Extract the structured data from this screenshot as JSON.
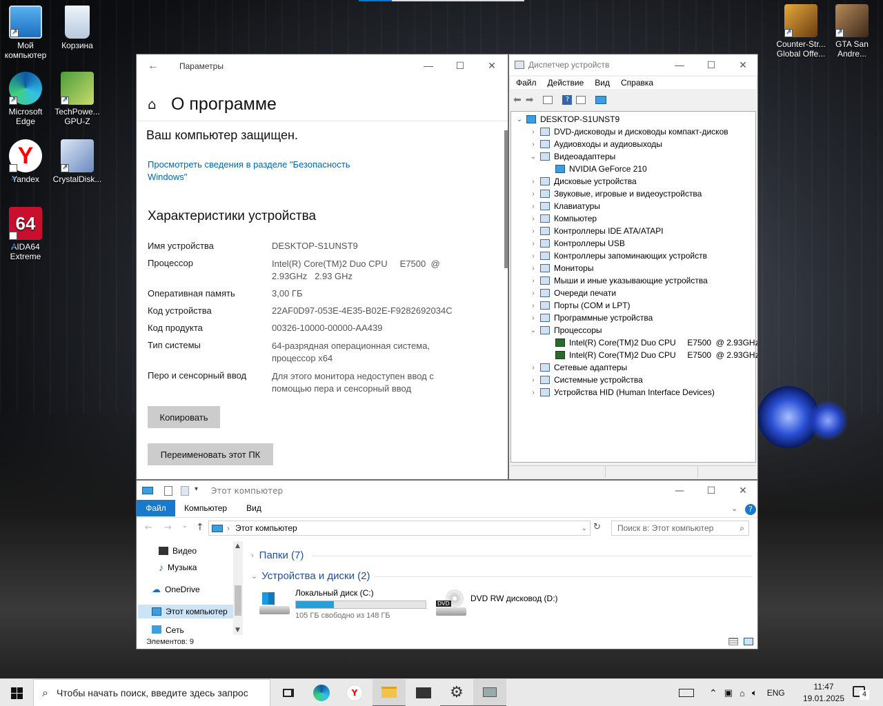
{
  "desktop": {
    "icons": [
      {
        "label": "Мой компьютер"
      },
      {
        "label": "Корзина"
      },
      {
        "label": "Microsoft Edge"
      },
      {
        "label": "TechPowe... GPU-Z"
      },
      {
        "label": "Yandex"
      },
      {
        "label": "CrystalDisk..."
      },
      {
        "label": "AIDA64 Extreme"
      },
      {
        "label": "Counter-Str... Global Offe..."
      },
      {
        "label": "GTA San Andre..."
      }
    ]
  },
  "settings": {
    "window_title": "Параметры",
    "page_title": "О программе",
    "protected_text": "Ваш компьютер защищен.",
    "security_link": "Просмотреть сведения в разделе \"Безопасность Windows\"",
    "specs_heading": "Характеристики устройства",
    "specs": [
      {
        "label": "Имя устройства",
        "value": "DESKTOP-S1UNST9"
      },
      {
        "label": "Процессор",
        "value": "Intel(R) Core(TM)2 Duo CPU     E7500  @ 2.93GHz   2.93 GHz"
      },
      {
        "label": "Оперативная память",
        "value": "3,00 ГБ"
      },
      {
        "label": "Код устройства",
        "value": "22AF0D97-053E-4E35-B02E-F9282692034C"
      },
      {
        "label": "Код продукта",
        "value": "00326-10000-00000-AA439"
      },
      {
        "label": "Тип системы",
        "value": "64-разрядная операционная система, процессор x64"
      },
      {
        "label": "Перо и сенсорный ввод",
        "value": "Для этого монитора недоступен ввод с помощью пера и сенсорный ввод"
      }
    ],
    "copy_button": "Копировать",
    "rename_button": "Переименовать этот ПК"
  },
  "devmgr": {
    "window_title": "Диспетчер устройств",
    "menu": [
      "Файл",
      "Действие",
      "Вид",
      "Справка"
    ],
    "root": "DESKTOP-S1UNST9",
    "items": [
      {
        "label": "DVD-дисководы и дисководы компакт-дисков",
        "expanded": false
      },
      {
        "label": "Аудиовходы и аудиовыходы",
        "expanded": false
      },
      {
        "label": "Видеоадаптеры",
        "expanded": true
      },
      {
        "label": "NVIDIA GeForce 210",
        "child": true
      },
      {
        "label": "Дисковые устройства",
        "expanded": false
      },
      {
        "label": "Звуковые, игровые и видеоустройства",
        "expanded": false
      },
      {
        "label": "Клавиатуры",
        "expanded": false
      },
      {
        "label": "Компьютер",
        "expanded": false
      },
      {
        "label": "Контроллеры IDE ATA/ATAPI",
        "expanded": false
      },
      {
        "label": "Контроллеры USB",
        "expanded": false
      },
      {
        "label": "Контроллеры запоминающих устройств",
        "expanded": false
      },
      {
        "label": "Мониторы",
        "expanded": false
      },
      {
        "label": "Мыши и иные указывающие устройства",
        "expanded": false
      },
      {
        "label": "Очереди печати",
        "expanded": false
      },
      {
        "label": "Порты (COM и LPT)",
        "expanded": false
      },
      {
        "label": "Программные устройства",
        "expanded": false
      },
      {
        "label": "Процессоры",
        "expanded": true
      },
      {
        "label": "Intel(R) Core(TM)2 Duo CPU     E7500  @ 2.93GHz",
        "child": true
      },
      {
        "label": "Intel(R) Core(TM)2 Duo CPU     E7500  @ 2.93GHz",
        "child": true
      },
      {
        "label": "Сетевые адаптеры",
        "expanded": false
      },
      {
        "label": "Системные устройства",
        "expanded": false
      },
      {
        "label": "Устройства HID (Human Interface Devices)",
        "expanded": false
      }
    ]
  },
  "explorer": {
    "window_title": "Этот компьютер",
    "tabs": [
      "Файл",
      "Компьютер",
      "Вид"
    ],
    "address": "Этот компьютер",
    "search_placeholder": "Поиск в: Этот компьютер",
    "nav": [
      "Видео",
      "Музыка",
      "OneDrive",
      "Этот компьютер",
      "Сеть"
    ],
    "folders_group": "Папки (7)",
    "devices_group": "Устройства и диски (2)",
    "disk_c": {
      "name": "Локальный диск (C:)",
      "free": "105 ГБ свободно из 148 ГБ",
      "used_fraction": 0.29
    },
    "dvd": {
      "name": "DVD RW дисковод (D:)",
      "badge": "DVD"
    },
    "status": "Элементов: 9"
  },
  "taskbar": {
    "search_placeholder": "Чтобы начать поиск, введите здесь запрос",
    "lang": "ENG",
    "time": "11:47",
    "date": "19.01.2025",
    "notif_count": "4"
  },
  "colors": {
    "accent": "#0078d7",
    "link": "#0067b8",
    "disk_bar": "#26a0da"
  }
}
